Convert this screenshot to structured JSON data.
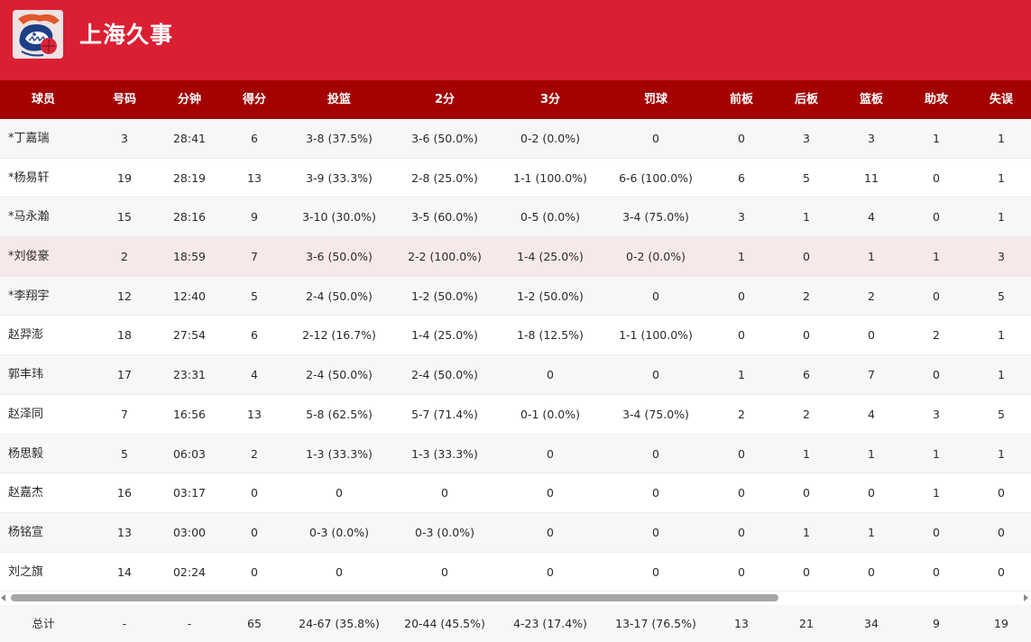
{
  "team": {
    "name": "上海久事",
    "logo_icon": "shanghai-sharks-logo-icon",
    "brand_color": "#db1f33",
    "header_color": "#a30102"
  },
  "columns": [
    "球员",
    "号码",
    "分钟",
    "得分",
    "投篮",
    "2分",
    "3分",
    "罚球",
    "前板",
    "后板",
    "篮板",
    "助攻",
    "失误"
  ],
  "players": [
    {
      "name": "*丁嘉瑞",
      "number": "3",
      "minutes": "28:41",
      "points": "6",
      "fg": "3-8 (37.5%)",
      "two": "3-6 (50.0%)",
      "three": "0-2 (0.0%)",
      "ft": "0",
      "oreb": "0",
      "dreb": "3",
      "reb": "3",
      "ast": "1",
      "tov": "1"
    },
    {
      "name": "*杨易轩",
      "number": "19",
      "minutes": "28:19",
      "points": "13",
      "fg": "3-9 (33.3%)",
      "two": "2-8 (25.0%)",
      "three": "1-1 (100.0%)",
      "ft": "6-6 (100.0%)",
      "oreb": "6",
      "dreb": "5",
      "reb": "11",
      "ast": "0",
      "tov": "1"
    },
    {
      "name": "*马永瀚",
      "number": "15",
      "minutes": "28:16",
      "points": "9",
      "fg": "3-10 (30.0%)",
      "two": "3-5 (60.0%)",
      "three": "0-5 (0.0%)",
      "ft": "3-4 (75.0%)",
      "oreb": "3",
      "dreb": "1",
      "reb": "4",
      "ast": "0",
      "tov": "1"
    },
    {
      "name": "*刘俊豪",
      "number": "2",
      "minutes": "18:59",
      "points": "7",
      "fg": "3-6 (50.0%)",
      "two": "2-2 (100.0%)",
      "three": "1-4 (25.0%)",
      "ft": "0-2 (0.0%)",
      "oreb": "1",
      "dreb": "0",
      "reb": "1",
      "ast": "1",
      "tov": "3"
    },
    {
      "name": "*李翔宇",
      "number": "12",
      "minutes": "12:40",
      "points": "5",
      "fg": "2-4 (50.0%)",
      "two": "1-2 (50.0%)",
      "three": "1-2 (50.0%)",
      "ft": "0",
      "oreb": "0",
      "dreb": "2",
      "reb": "2",
      "ast": "0",
      "tov": "5"
    },
    {
      "name": "赵羿澎",
      "number": "18",
      "minutes": "27:54",
      "points": "6",
      "fg": "2-12 (16.7%)",
      "two": "1-4 (25.0%)",
      "three": "1-8 (12.5%)",
      "ft": "1-1 (100.0%)",
      "oreb": "0",
      "dreb": "0",
      "reb": "0",
      "ast": "2",
      "tov": "1"
    },
    {
      "name": "郭丰玮",
      "number": "17",
      "minutes": "23:31",
      "points": "4",
      "fg": "2-4 (50.0%)",
      "two": "2-4 (50.0%)",
      "three": "0",
      "ft": "0",
      "oreb": "1",
      "dreb": "6",
      "reb": "7",
      "ast": "0",
      "tov": "1"
    },
    {
      "name": "赵泽同",
      "number": "7",
      "minutes": "16:56",
      "points": "13",
      "fg": "5-8 (62.5%)",
      "two": "5-7 (71.4%)",
      "three": "0-1 (0.0%)",
      "ft": "3-4 (75.0%)",
      "oreb": "2",
      "dreb": "2",
      "reb": "4",
      "ast": "3",
      "tov": "5"
    },
    {
      "name": "杨思毅",
      "number": "5",
      "minutes": "06:03",
      "points": "2",
      "fg": "1-3 (33.3%)",
      "two": "1-3 (33.3%)",
      "three": "0",
      "ft": "0",
      "oreb": "0",
      "dreb": "1",
      "reb": "1",
      "ast": "1",
      "tov": "1"
    },
    {
      "name": "赵嘉杰",
      "number": "16",
      "minutes": "03:17",
      "points": "0",
      "fg": "0",
      "two": "0",
      "three": "0",
      "ft": "0",
      "oreb": "0",
      "dreb": "0",
      "reb": "0",
      "ast": "1",
      "tov": "0"
    },
    {
      "name": "杨铭宣",
      "number": "13",
      "minutes": "03:00",
      "points": "0",
      "fg": "0-3 (0.0%)",
      "two": "0-3 (0.0%)",
      "three": "0",
      "ft": "0",
      "oreb": "0",
      "dreb": "1",
      "reb": "1",
      "ast": "0",
      "tov": "0"
    },
    {
      "name": "刘之旗",
      "number": "14",
      "minutes": "02:24",
      "points": "0",
      "fg": "0",
      "two": "0",
      "three": "0",
      "ft": "0",
      "oreb": "0",
      "dreb": "0",
      "reb": "0",
      "ast": "0",
      "tov": "0"
    }
  ],
  "highlighted_row": 3,
  "totals": {
    "name": "总计",
    "number": "-",
    "minutes": "-",
    "points": "65",
    "fg": "24-67 (35.8%)",
    "two": "20-44 (45.5%)",
    "three": "4-23 (17.4%)",
    "ft": "13-17 (76.5%)",
    "oreb": "13",
    "dreb": "21",
    "reb": "34",
    "ast": "9",
    "tov": "19"
  },
  "scroll": {
    "position": 0.0,
    "visible_fraction": 0.75
  }
}
